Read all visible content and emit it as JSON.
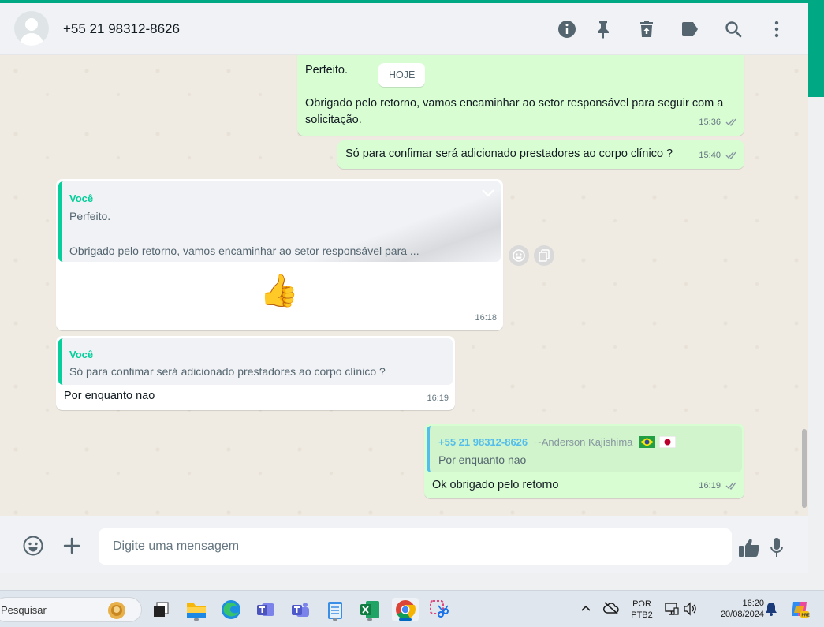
{
  "header": {
    "contact": "+55 21 98312-8626",
    "icons": [
      "info-icon",
      "pin-icon",
      "delete-icon",
      "label-icon",
      "search-icon",
      "menu-icon"
    ]
  },
  "chat": {
    "date_chip": "HOJE",
    "messages": [
      {
        "text1": "Perfeito.",
        "text2": "Obrigado pelo retorno, vamos encaminhar ao setor responsável para seguir com a solicitação.",
        "time": "15:36"
      },
      {
        "text": "Só para confimar será adicionado prestadores ao corpo clínico ?",
        "time": "15:40"
      },
      {
        "quote_author": "Você",
        "quote_line1": "Perfeito.",
        "quote_line2": "Obrigado pelo retorno, vamos encaminhar ao setor responsável para ...",
        "emoji": "👍",
        "time": "16:18"
      },
      {
        "quote_author": "Você",
        "quote_text": "Só para confimar será adicionado prestadores ao corpo clínico ?",
        "text": "Por enquanto nao",
        "time": "16:19"
      },
      {
        "quote_author": "+55 21 98312-8626",
        "quote_pushname": "~Anderson Kajishima",
        "quote_text": "Por enquanto nao",
        "text": "Ok obrigado pelo retorno",
        "time": "16:19"
      }
    ]
  },
  "composer": {
    "placeholder": "Digite uma mensagem"
  },
  "taskbar": {
    "search_label": "Pesquisar",
    "lang_top": "POR",
    "lang_bottom": "PTB2",
    "clock_time": "16:20",
    "clock_date": "20/08/2024"
  },
  "colors": {
    "accent": "#00a884",
    "outgoing_bubble": "#d9fdd3",
    "incoming_bubble": "#ffffff",
    "chat_bg": "#efeae2",
    "read_ticks": "#8696a0"
  }
}
